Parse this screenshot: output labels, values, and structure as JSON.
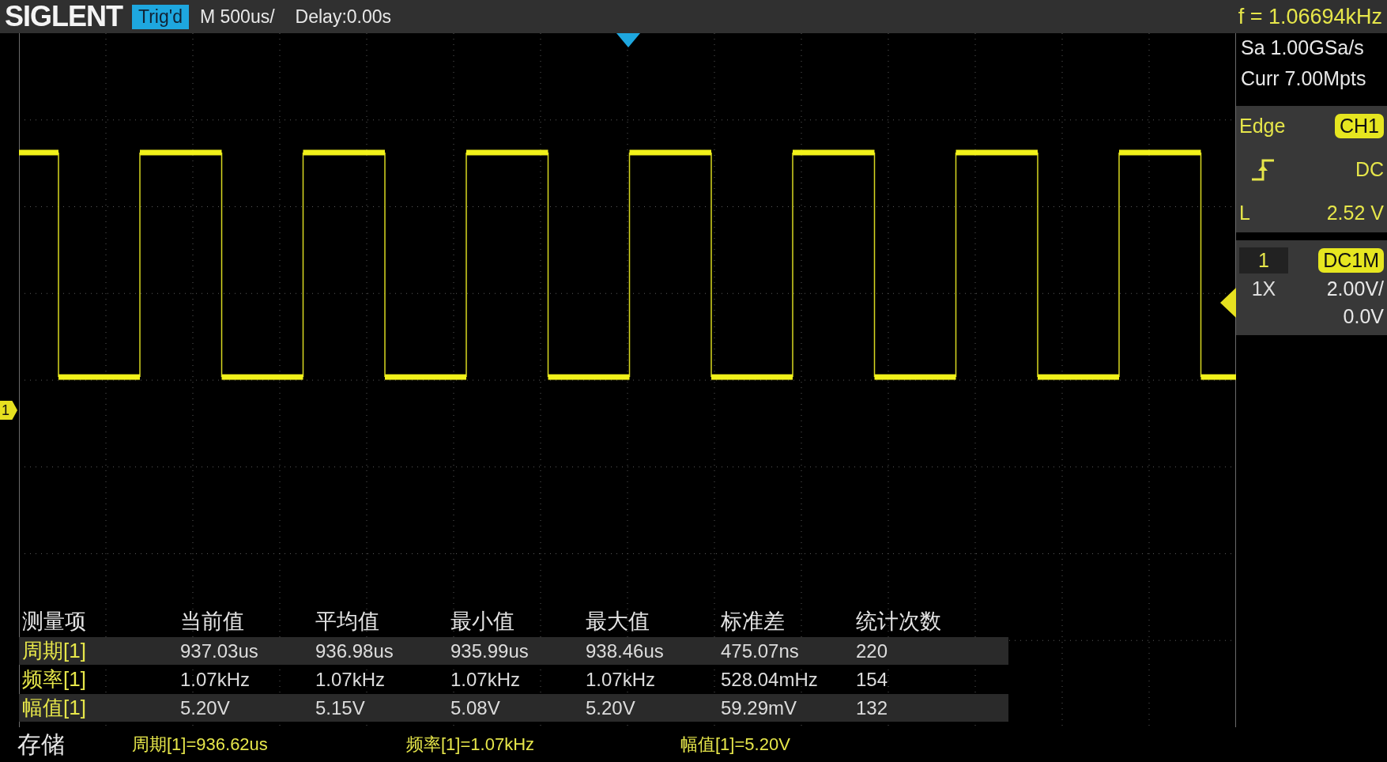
{
  "header": {
    "brand": "SIGLENT",
    "trigger_status": "Trig'd",
    "timebase": "M 500us/",
    "delay": "Delay:0.00s",
    "frequency": "f = 1.06694kHz"
  },
  "acquisition": {
    "sample_rate": "Sa 1.00GSa/s",
    "memory_depth": "Curr 7.00Mpts"
  },
  "trigger": {
    "type": "Edge",
    "source": "CH1",
    "coupling": "DC",
    "level_label": "L",
    "level_value": "2.52 V"
  },
  "channel": {
    "number": "1",
    "coupling": "DC1M",
    "probe": "1X",
    "scale": "2.00V/",
    "offset": "0.0V"
  },
  "waveform": {
    "channel_marker": "1"
  },
  "measurements": {
    "columns": [
      "测量项",
      "当前值",
      "平均值",
      "最小值",
      "最大值",
      "标准差",
      "统计次数"
    ],
    "rows": [
      {
        "cells": [
          "周期[1]",
          "937.03us",
          "936.98us",
          "935.99us",
          "938.46us",
          "475.07ns",
          "220"
        ]
      },
      {
        "cells": [
          "频率[1]",
          "1.07kHz",
          "1.07kHz",
          "1.07kHz",
          "1.07kHz",
          "528.04mHz",
          "154"
        ]
      },
      {
        "cells": [
          "幅值[1]",
          "5.20V",
          "5.15V",
          "5.08V",
          "5.20V",
          "59.29mV",
          "132"
        ]
      }
    ]
  },
  "status_bar": {
    "mode": "存储",
    "readouts": [
      "周期[1]=936.62us",
      "频率[1]=1.07kHz",
      "幅值[1]=5.20V"
    ]
  }
}
